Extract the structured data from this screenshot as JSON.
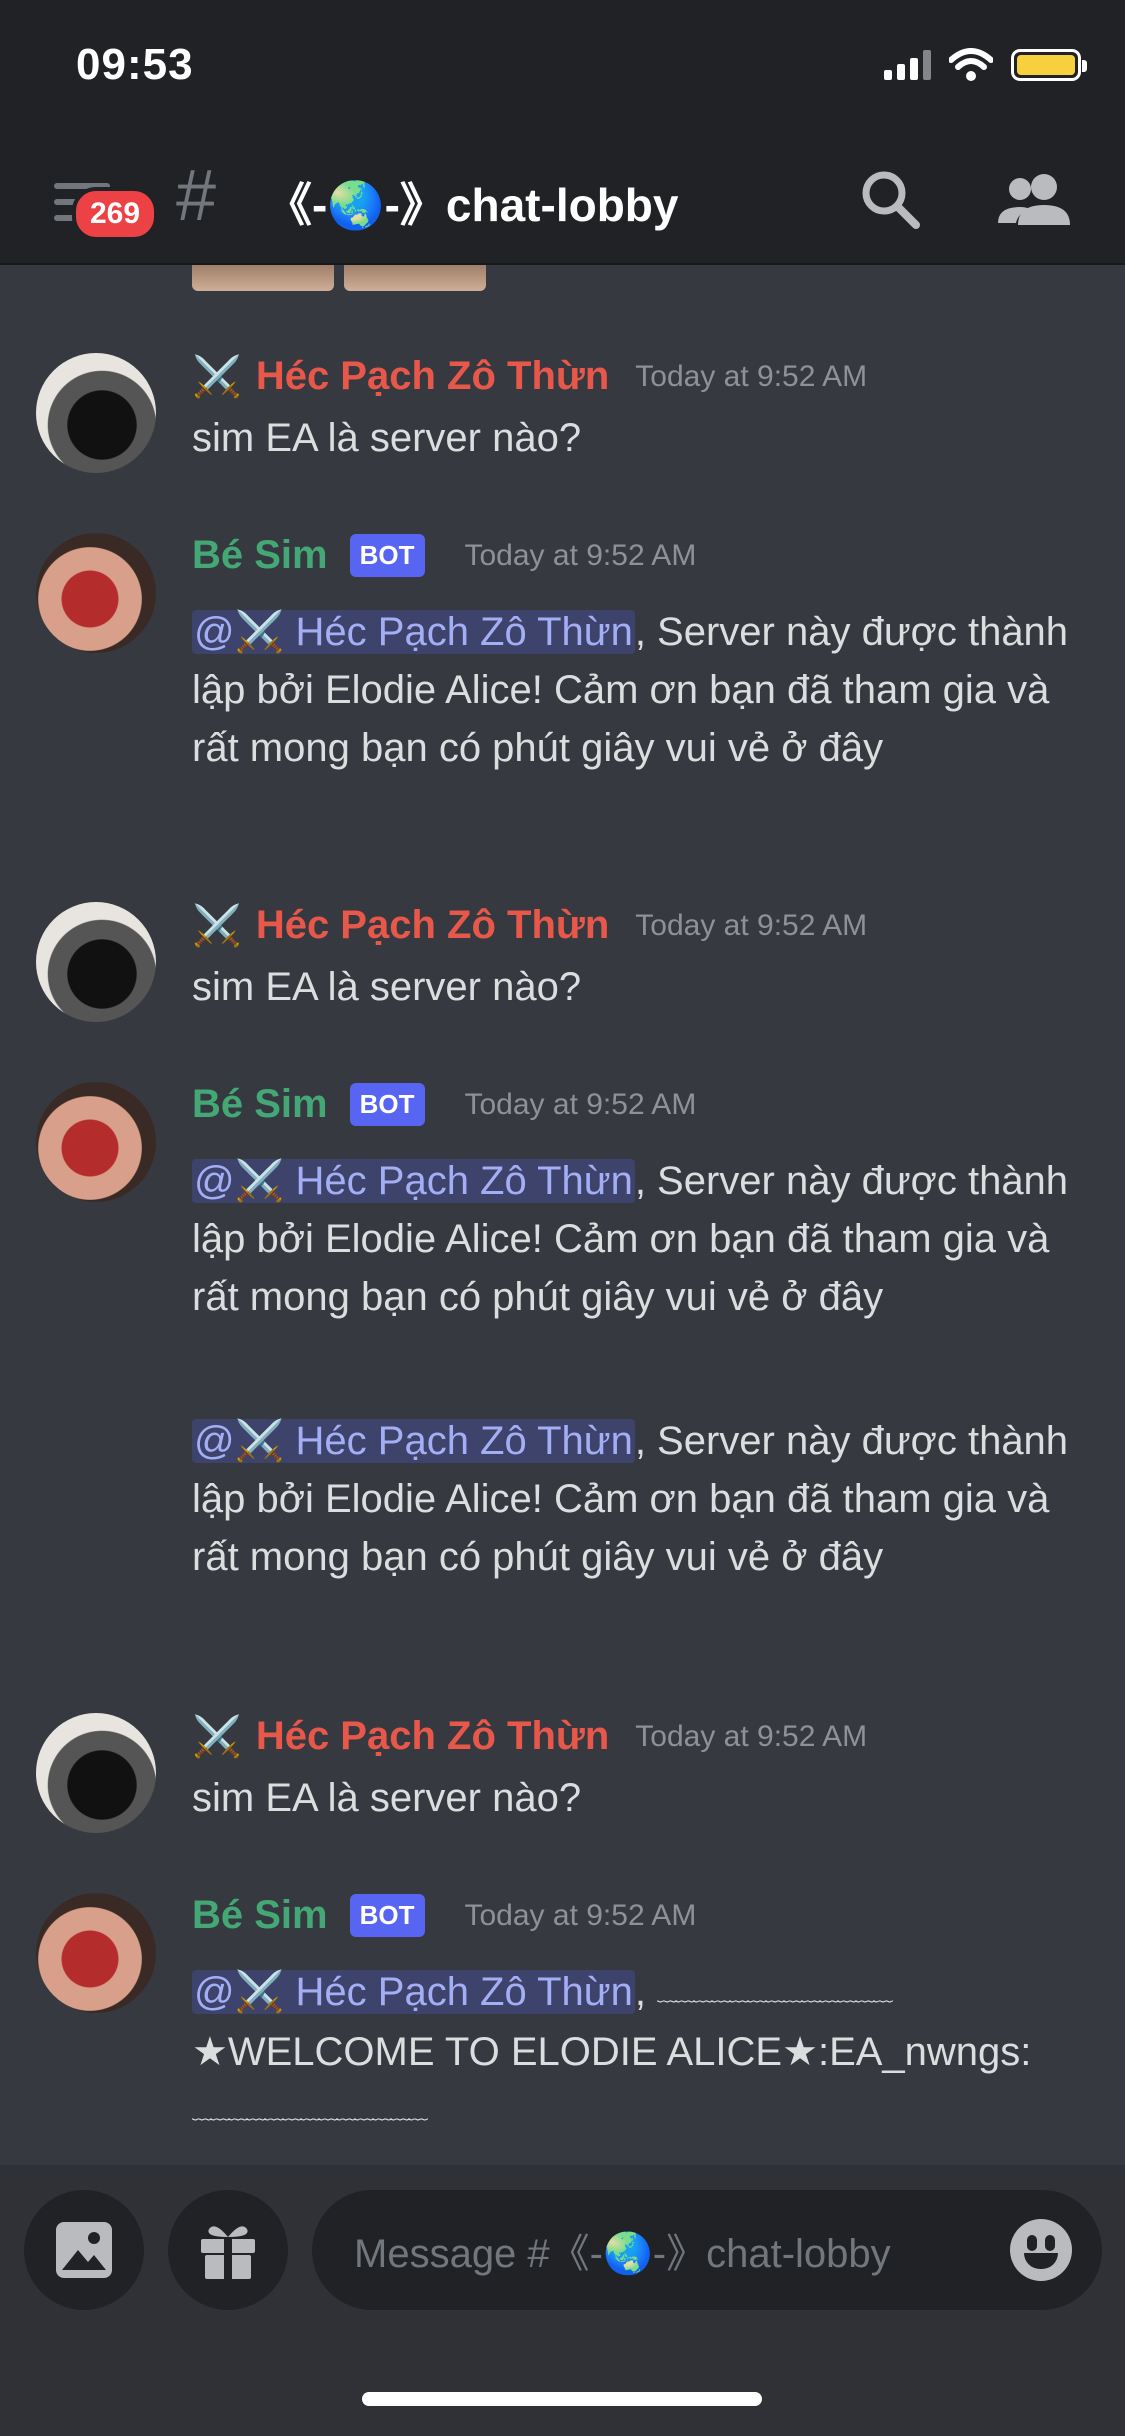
{
  "status_bar": {
    "time": "09:53"
  },
  "header": {
    "unread_badge": "269",
    "channel_hash": "#",
    "channel_name": "《-🌏-》chat-lobby"
  },
  "messages": [
    {
      "author": "Héc Pạch Zô Thừn",
      "author_prefix": "⚔️",
      "bot": false,
      "timestamp": "Today at 9:52 AM",
      "lines": [
        "sim EA là server nào?"
      ]
    },
    {
      "author": "Bé Sim",
      "bot": true,
      "bot_label": "BOT",
      "timestamp": "Today at 9:52 AM",
      "mention": "@⚔️ Héc Pạch Zô Thừn",
      "text_after_mention": ", Server này được thành lập bởi Elodie Alice!  Cảm ơn bạn đã tham gia và rất mong bạn có phút giây vui vẻ ở đây"
    },
    {
      "author": "Héc Pạch Zô Thừn",
      "author_prefix": "⚔️",
      "bot": false,
      "timestamp": "Today at 9:52 AM",
      "lines": [
        "sim EA là server nào?"
      ]
    },
    {
      "author": "Bé Sim",
      "bot": true,
      "bot_label": "BOT",
      "timestamp": "Today at 9:52 AM",
      "mention": "@⚔️ Héc Pạch Zô Thừn",
      "text_after_mention": ", Server này được thành lập bởi Elodie Alice!  Cảm ơn bạn đã tham gia và rất mong bạn có phút giây vui vẻ ở đây",
      "mention_2": "@⚔️ Héc Pạch Zô Thừn",
      "text_after_mention_2": ", Server này được thành lập bởi Elodie Alice!  Cảm ơn bạn đã tham gia và rất mong bạn có phút giây vui vẻ ở đây"
    },
    {
      "author": "Héc Pạch Zô Thừn",
      "author_prefix": "⚔️",
      "bot": false,
      "timestamp": "Today at 9:52 AM",
      "lines": [
        "sim EA là server nào?"
      ]
    },
    {
      "author": "Bé Sim",
      "bot": true,
      "bot_label": "BOT",
      "timestamp": "Today at 9:52 AM",
      "mention": "@⚔️ Héc Pạch Zô Thừn",
      "text_after_mention": ", ",
      "wavy_1": "﹏﹏﹏﹏﹏﹏﹏﹏﹏﹏﹏﹏﹏",
      "welcome": "★WELCOME TO ELODIE ALICE★:EA_nwngs:",
      "wavy_2": "﹏﹏﹏﹏﹏﹏﹏﹏﹏﹏﹏﹏﹏"
    }
  ],
  "composer": {
    "placeholder": "Message #《-🌏-》chat-lobby"
  },
  "colors": {
    "background": "#36393f",
    "header": "#202225",
    "user_name": "#e8584a",
    "bot_name": "#43a776",
    "bot_tag": "#5865f2",
    "mention": "#a4aef5"
  },
  "icons": [
    "channel-menu-icon",
    "hash-icon",
    "search-icon",
    "members-icon",
    "image-icon",
    "gift-icon",
    "emoji-icon"
  ]
}
